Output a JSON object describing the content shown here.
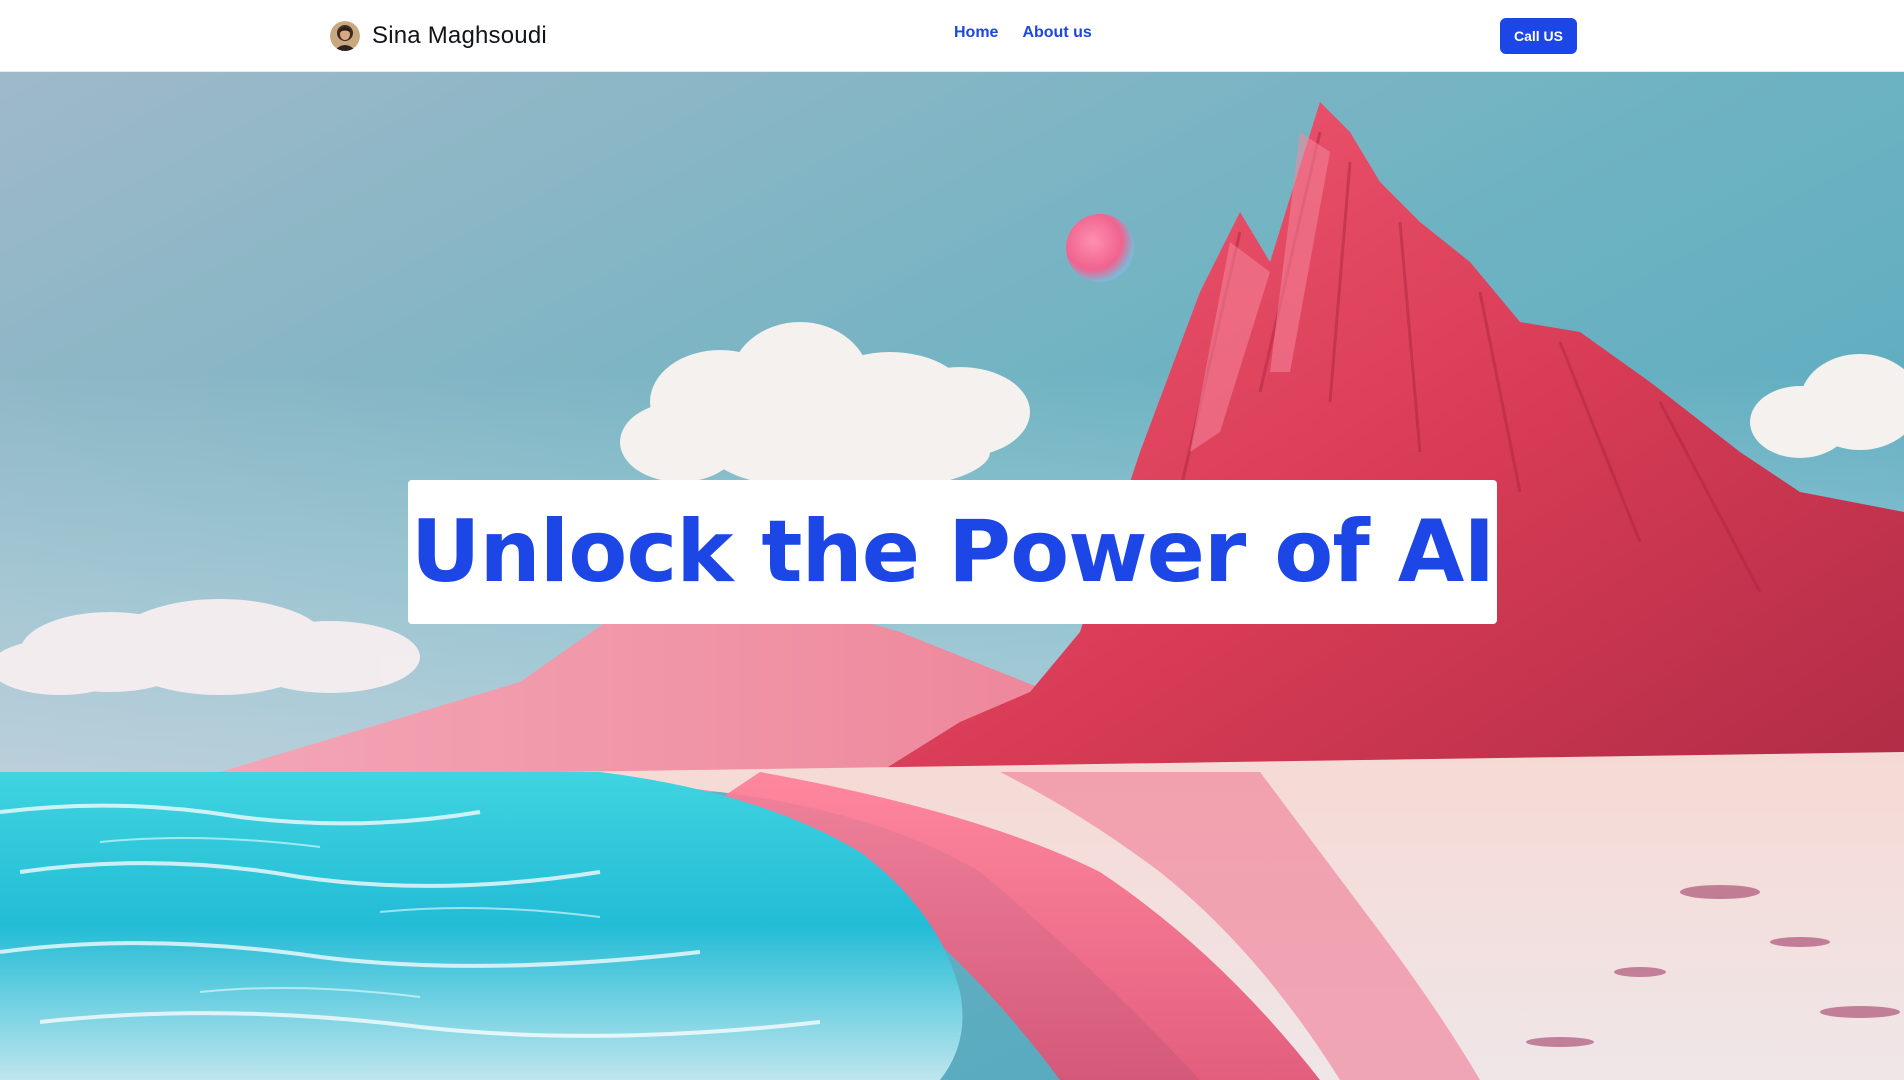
{
  "header": {
    "brand_name": "Sina Maghsoudi",
    "avatar_icon": "profile-avatar",
    "nav": [
      {
        "label": "Home"
      },
      {
        "label": "About us"
      }
    ],
    "cta_label": "Call US"
  },
  "hero": {
    "headline": "Unlock the Power of AI",
    "background": "mountain-beach-landscape"
  },
  "colors": {
    "accent": "#1c46e6",
    "sky": "#6fb6c4",
    "mountain": "#e2485f",
    "sea": "#27c6d8",
    "sand": "#f3e9e4"
  }
}
